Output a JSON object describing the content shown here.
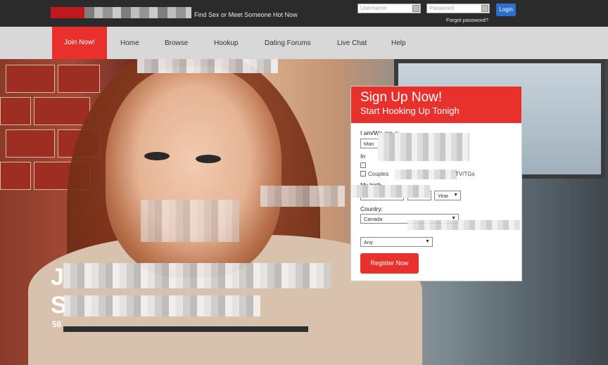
{
  "topbar": {
    "tagline": "Find Sex or Meet Someone Hot Now",
    "username_placeholder": "Username",
    "password_placeholder": "Password",
    "login_label": "Login",
    "forgot_label": "Forgot password?"
  },
  "nav": {
    "join_label": "Join Now!",
    "items": [
      {
        "label": "Home"
      },
      {
        "label": "Browse"
      },
      {
        "label": "Hookup"
      },
      {
        "label": "Dating Forums"
      },
      {
        "label": "Live Chat"
      },
      {
        "label": "Help"
      }
    ]
  },
  "hero": {
    "headline1": "J",
    "headline2": "S",
    "count": "58"
  },
  "signup": {
    "title": "Sign Up Now!",
    "subtitle": "Start Hooking Up Tonigh",
    "iam_label": "I am/We are a:",
    "iam_value": "Man",
    "interest_label": "In",
    "cb_couples": "Couples",
    "cb_tv": "TV/TGs",
    "birth_label": "My birth",
    "year_value": "Year",
    "country_label": "Country:",
    "country_value": "Canada",
    "any_value": "Any",
    "register_label": "Register Now"
  },
  "colors": {
    "accent_red": "#e8312c",
    "login_blue": "#2b6fd1",
    "topbar": "#2b2b2b"
  }
}
